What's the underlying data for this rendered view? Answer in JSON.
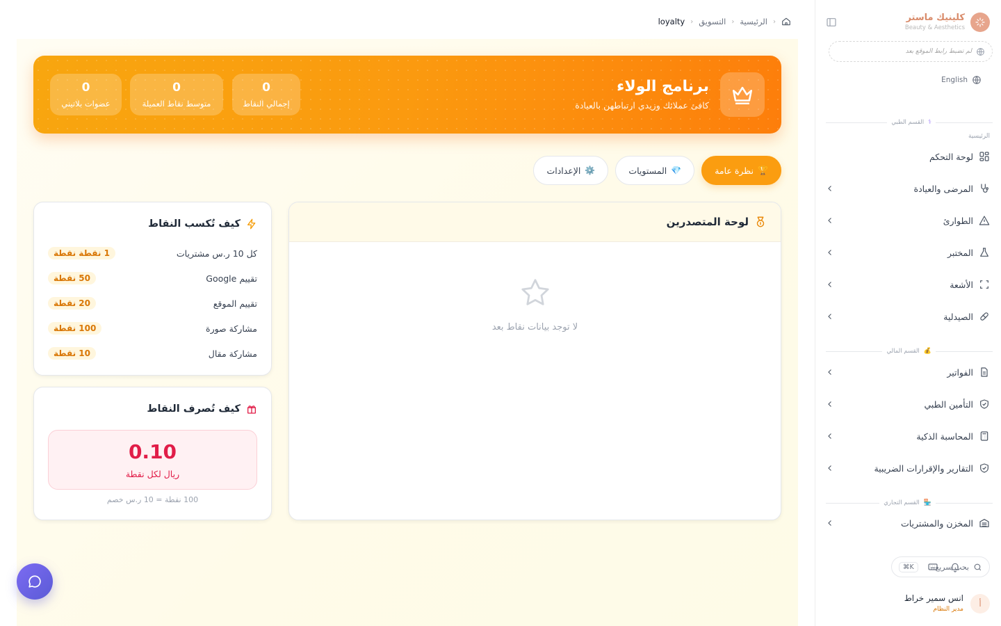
{
  "colors": {
    "accent": "#fb9d10",
    "hero_start": "#f8a60f",
    "hero_end": "#fd7e0b",
    "brand": "#d98b6a",
    "rose": "#e11d48",
    "fab": "#6366f1"
  },
  "sidebar": {
    "brand_name": "كلينيك ماستر",
    "brand_sub": "Beauty & Aesthetics",
    "site_link": "لم تضبط رابط الموقع بعد",
    "language": "English",
    "sections": {
      "medical": "القسم الطبي",
      "financial": "القسم المالي",
      "commercial": "القسم التجاري"
    },
    "sub_label": "الرئيسية",
    "items": [
      {
        "label": "لوحة التحكم",
        "icon": "grid-icon"
      },
      {
        "label": "المرضى والعيادة",
        "icon": "stethoscope-icon"
      },
      {
        "label": "الطوارئ",
        "icon": "warning-icon"
      },
      {
        "label": "المختبر",
        "icon": "flask-icon"
      },
      {
        "label": "الأشعة",
        "icon": "scan-icon"
      },
      {
        "label": "الصيدلية",
        "icon": "pill-icon"
      },
      {
        "label": "الفواتير",
        "icon": "document-icon"
      },
      {
        "label": "التأمين الطبي",
        "icon": "shield-check-icon"
      },
      {
        "label": "المحاسبة الذكية",
        "icon": "calculator-icon"
      },
      {
        "label": "التقارير والإقرارات الضريبية",
        "icon": "shield-check-icon"
      },
      {
        "label": "المخزن والمشتريات",
        "icon": "warehouse-icon"
      }
    ],
    "search_placeholder": "بحث سريع...",
    "search_shortcut": "⌘K",
    "user_initial": "أ",
    "user_name": "انس سمير خراط",
    "user_role": "مدير النظام"
  },
  "breadcrumb": {
    "home": "الرئيسية",
    "marketing": "التسويق",
    "current": "loyalty"
  },
  "hero": {
    "title": "برنامج الولاء",
    "subtitle": "كافئ عملائك وزيدي ارتباطهن بالعيادة",
    "stats": [
      {
        "value": "0",
        "label": "إجمالي النقاط"
      },
      {
        "value": "0",
        "label": "متوسط نقاط العميلة"
      },
      {
        "value": "0",
        "label": "عضوات بلاتيني"
      }
    ]
  },
  "tabs": [
    {
      "emoji": "🏆",
      "label": "نظرة عامة",
      "active": true
    },
    {
      "emoji": "💎",
      "label": "المستويات",
      "active": false
    },
    {
      "emoji": "⚙️",
      "label": "الإعدادات",
      "active": false
    }
  ],
  "leaderboard": {
    "title": "لوحة المتصدرين",
    "empty_message": "لا توجد بيانات نقاط بعد"
  },
  "earn": {
    "title": "كيف تُكسب النقاط",
    "rows": [
      {
        "label": "كل 10 ر.س مشتريات",
        "points": "1 نقطة نقطة"
      },
      {
        "label": "تقييم Google",
        "points": "50 نقطة"
      },
      {
        "label": "تقييم الموقع",
        "points": "20 نقطة"
      },
      {
        "label": "مشاركة صورة",
        "points": "100 نقطة"
      },
      {
        "label": "مشاركة مقال",
        "points": "10 نقطة"
      }
    ]
  },
  "spend": {
    "title": "كيف تُصرف النقاط",
    "rate_value": "0.10",
    "rate_label": "ريال لكل نقطة",
    "note": "100 نقطة = 10 ر.س خصم"
  }
}
